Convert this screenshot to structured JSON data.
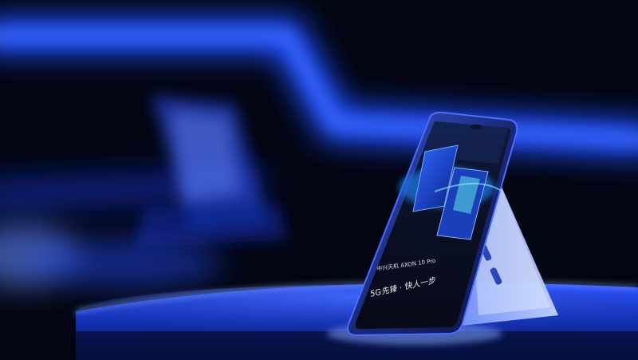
{
  "photo": {
    "subject": "smartphone-on-display-stand",
    "colors": {
      "background": "#030512",
      "neon_light": "#1d4dff",
      "phone_frame": "#1a2a6a",
      "screen": "#0a0e1e",
      "stand": "#a8c4ff"
    }
  },
  "screen_content": {
    "brand_line": "中兴天机 AXON 10 Pro",
    "slogan": "5G先锋 · 快人一步"
  }
}
